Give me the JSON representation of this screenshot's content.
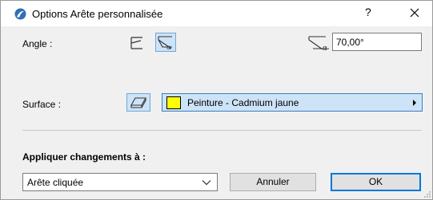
{
  "window": {
    "title": "Options Arête personnalisée",
    "help_label": "?"
  },
  "angle": {
    "label": "Angle :",
    "value": "70,00°",
    "angle_symbol": "α"
  },
  "surface": {
    "label": "Surface :",
    "material": "Peinture - Cadmium jaune",
    "swatch_color": "#ffff00"
  },
  "apply": {
    "label": "Appliquer changements à :",
    "selected": "Arête cliquée"
  },
  "buttons": {
    "cancel": "Annuler",
    "ok": "OK"
  },
  "colors": {
    "accent": "#0078d7",
    "selected_bg": "#cde3f7",
    "body_bg": "#f0f0f0"
  }
}
